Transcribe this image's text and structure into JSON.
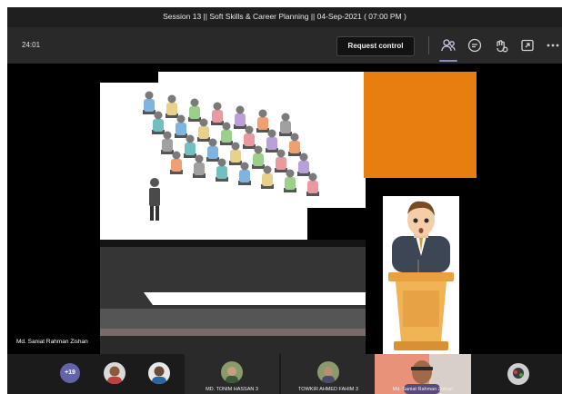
{
  "meeting": {
    "title": "Session 13 || Soft Skills & Career Planning || 04-Sep-2021 ( 07:00 PM )",
    "timer": "24:01"
  },
  "toolbar": {
    "request_control_label": "Request control",
    "icons": [
      "people-icon",
      "chat-icon",
      "reactions-icon",
      "share-tray-icon",
      "more-options-icon"
    ]
  },
  "stage": {
    "presenter_name": "Md. Saniat Rahman Zishan"
  },
  "participants": {
    "overflow_count": "+19",
    "tiles": [
      {
        "name": "MD. TONIM HASSAN",
        "mic": "3"
      },
      {
        "name": "TOWKIR AHMED FAHIM",
        "mic": "3"
      },
      {
        "name": "Md. Saniat Rahman Zishan"
      }
    ]
  },
  "colors": {
    "accent": "#6264a7",
    "orange_shape": "#e87d10",
    "active_speaker": "#e8927a"
  }
}
